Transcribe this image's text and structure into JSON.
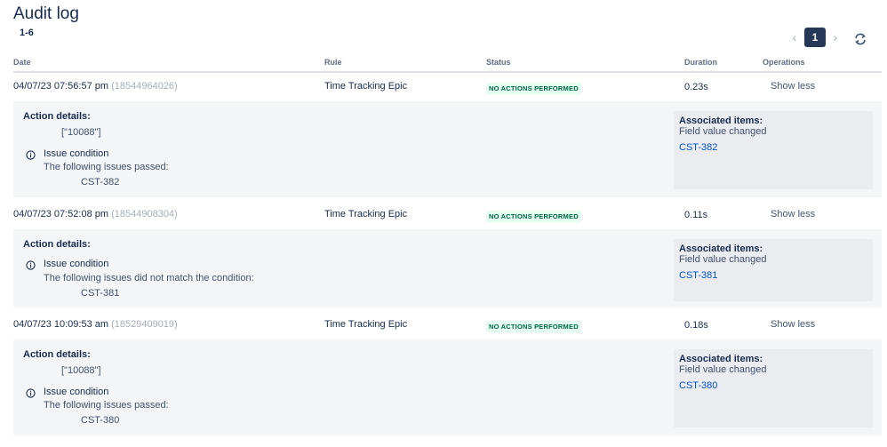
{
  "header": {
    "title": "Audit log",
    "range": "1-6"
  },
  "pagination": {
    "prev": "‹",
    "current_page": "1",
    "next": "›",
    "refresh_icon": "refresh-icon"
  },
  "columns": {
    "date": "Date",
    "rule": "Rule",
    "status": "Status",
    "duration": "Duration",
    "operations": "Operations"
  },
  "entries": [
    {
      "date": "04/07/23 07:56:57 pm",
      "id": "(18544964026)",
      "rule": "Time Tracking Epic",
      "status": "NO ACTIONS PERFORMED",
      "duration": "0.23s",
      "operation": "Show less",
      "action_details_label": "Action details:",
      "action_value": "[\"10088\"]",
      "condition_title": "Issue condition",
      "condition_text": "The following issues passed:",
      "condition_issue": "CST-382",
      "assoc_title": "Associated items:",
      "assoc_sub": "Field value changed",
      "assoc_link": "CST-382"
    },
    {
      "date": "04/07/23 07:52:08 pm",
      "id": "(18544908304)",
      "rule": "Time Tracking Epic",
      "status": "NO ACTIONS PERFORMED",
      "duration": "0.11s",
      "operation": "Show less",
      "action_details_label": "Action details:",
      "condition_title": "Issue condition",
      "condition_text": "The following issues did not match the condition:",
      "condition_issue": "CST-381",
      "assoc_title": "Associated items:",
      "assoc_sub": "Field value changed",
      "assoc_link": "CST-381"
    },
    {
      "date": "04/07/23 10:09:53 am",
      "id": "(18529409019)",
      "rule": "Time Tracking Epic",
      "status": "NO ACTIONS PERFORMED",
      "duration": "0.18s",
      "operation": "Show less",
      "action_details_label": "Action details:",
      "action_value": "[\"10088\"]",
      "condition_title": "Issue condition",
      "condition_text": "The following issues passed:",
      "condition_issue": "CST-380",
      "assoc_title": "Associated items:",
      "assoc_sub": "Field value changed",
      "assoc_link": "CST-380"
    }
  ],
  "colors": {
    "status_text": "#006644",
    "status_bg": "#e3fcef",
    "link": "#0052cc",
    "page_active": "#253858"
  }
}
